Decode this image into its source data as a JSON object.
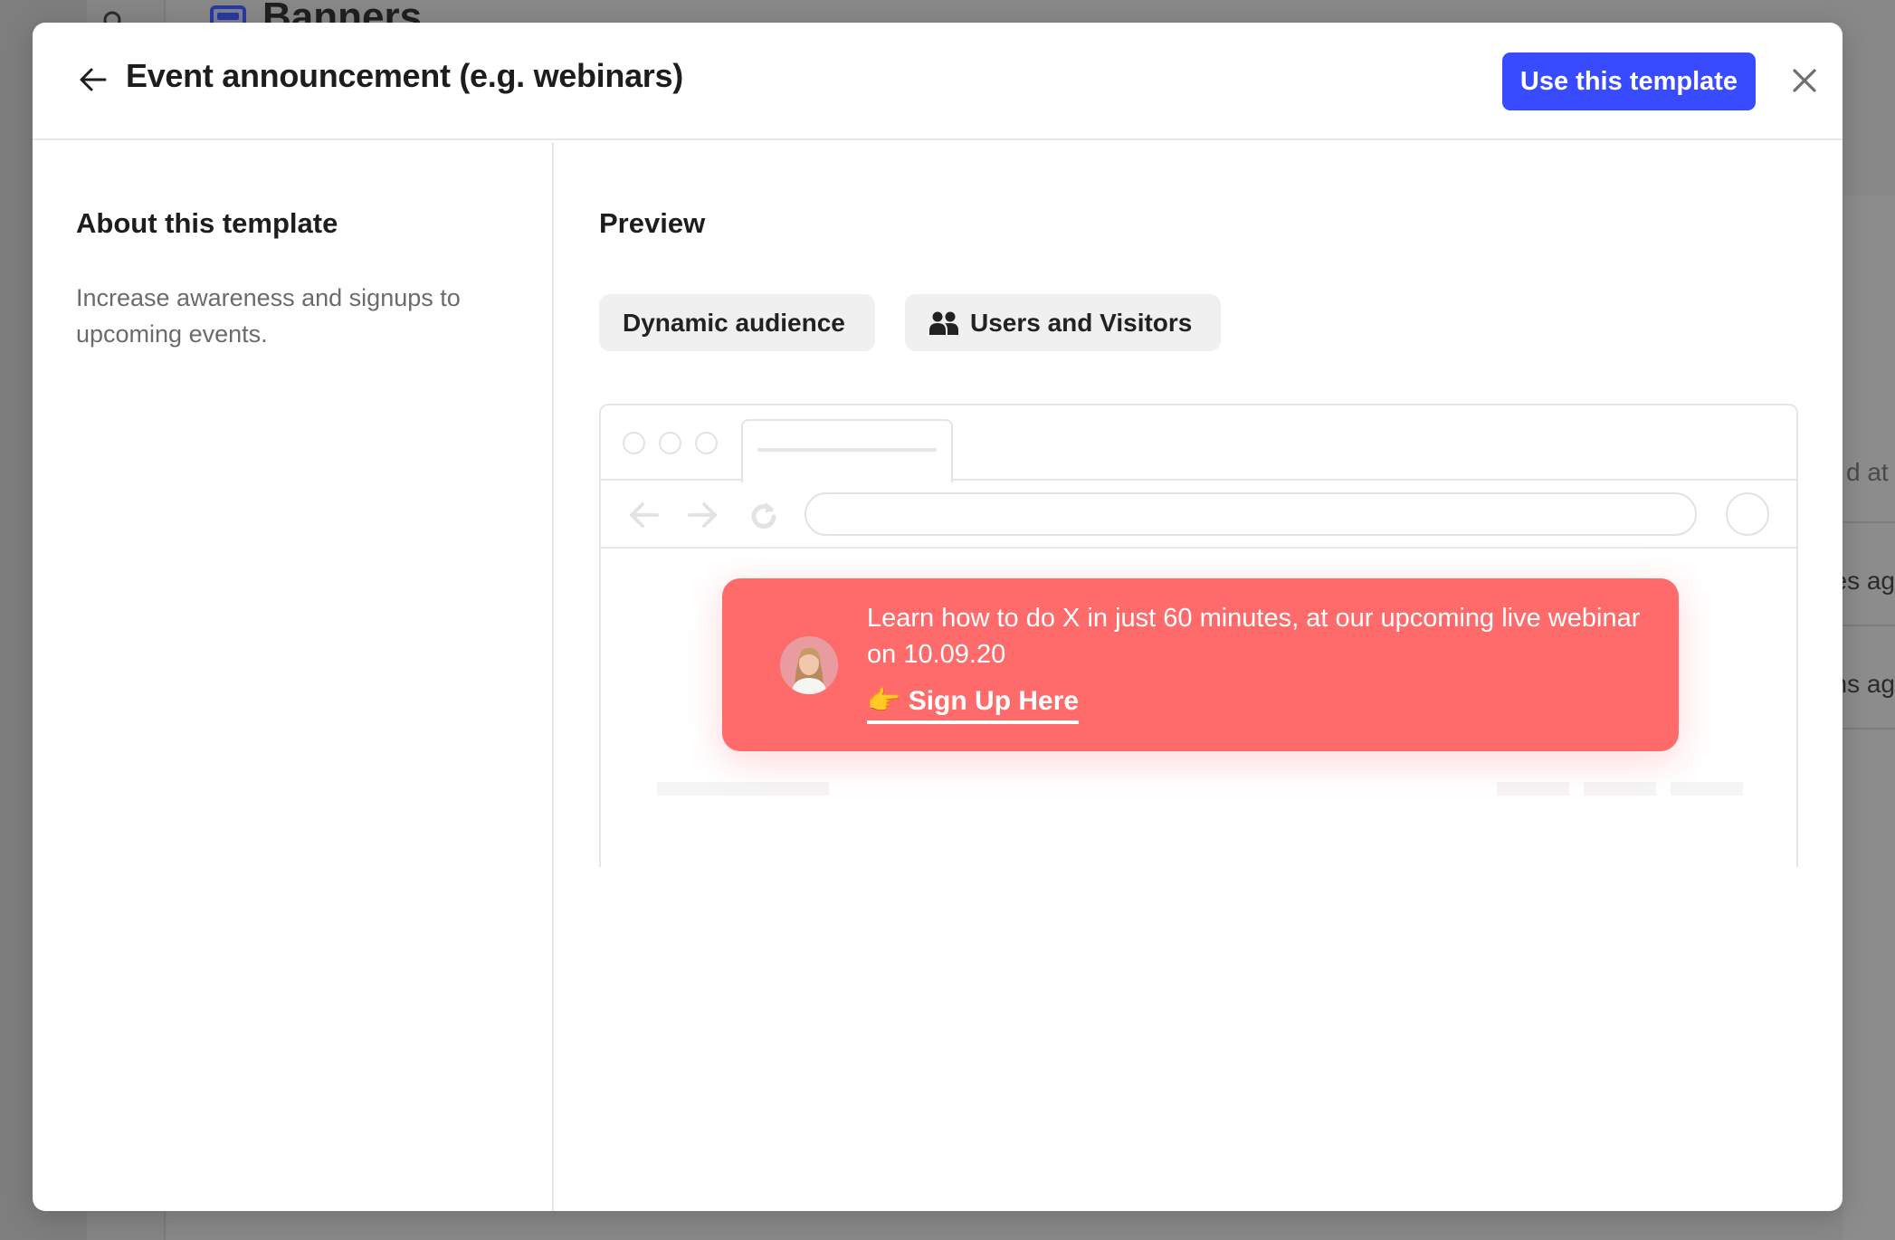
{
  "background": {
    "page_title": "Banners",
    "table_fragments": [
      "d at",
      "es ag",
      "hs ag"
    ]
  },
  "modal": {
    "title": "Event announcement (e.g. webinars)",
    "primary_button": "Use this template",
    "icons": {
      "back": "arrow-left-icon",
      "close": "close-icon"
    }
  },
  "about": {
    "heading": "About this template",
    "description": "Increase awareness and signups to upcoming events."
  },
  "preview": {
    "heading": "Preview",
    "chips": [
      {
        "label": "Dynamic audience",
        "icon": null
      },
      {
        "label": "Users and Visitors",
        "icon": "users-icon"
      }
    ],
    "banner": {
      "message": "Learn how to do X in just 60 minutes, at our upcoming live webinar on 10.09.20",
      "cta_emoji": "👉",
      "cta_label": "Sign Up Here",
      "background_color": "#ff6a6a"
    }
  },
  "colors": {
    "primary": "#384bff",
    "banner": "#ff6a6a",
    "chip_bg": "#f0f0f0",
    "muted_text": "#6b6b6b"
  }
}
